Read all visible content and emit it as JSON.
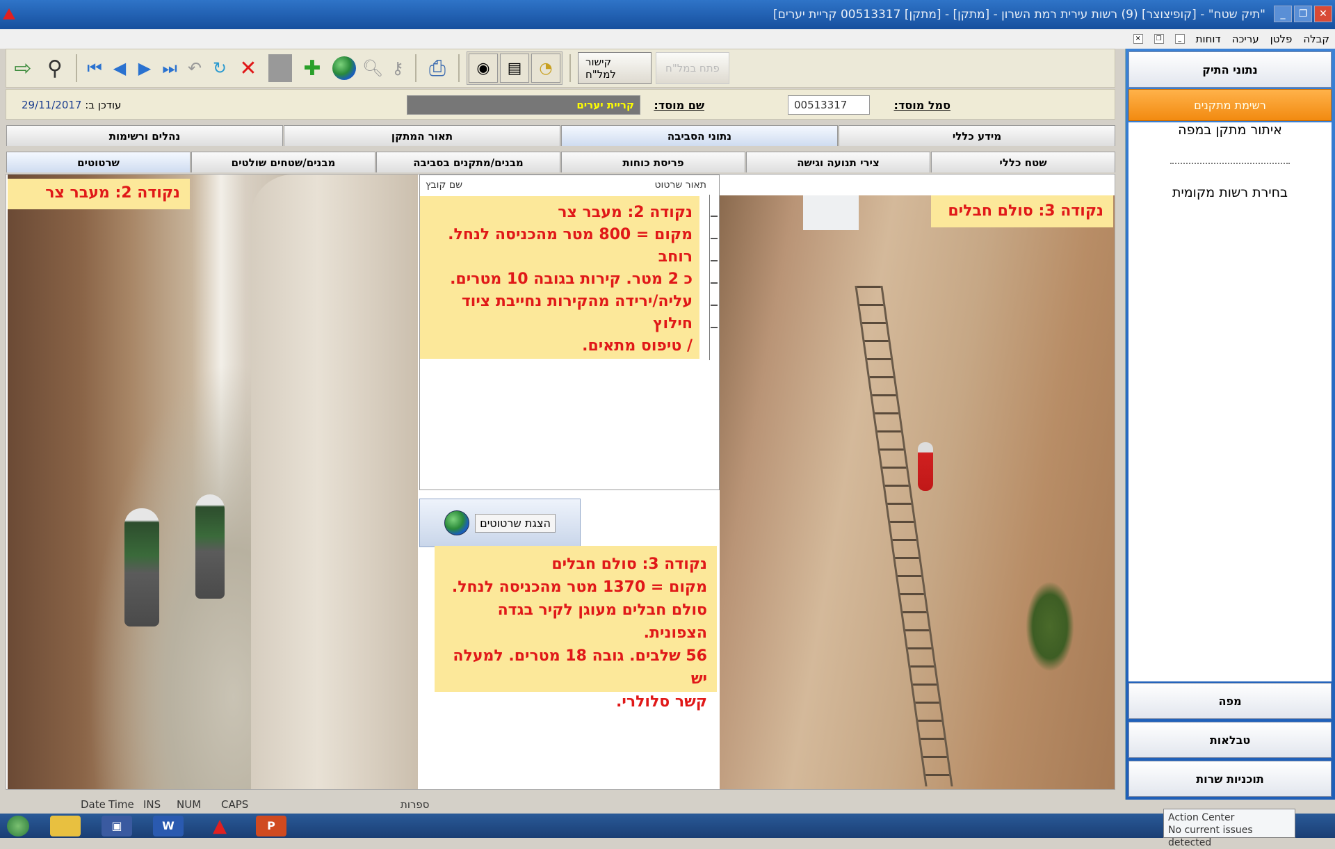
{
  "window": {
    "title": "\"תיק שטח\" - [קופיצוצר] (9) רשות עירית רמת השרון - [מתקן] - [מתקן] 00513317 קריית יערים]"
  },
  "menu": {
    "items": [
      "קבלה",
      "פלטן",
      "עריכה",
      "דוחות"
    ]
  },
  "toolbar": {
    "icons": [
      "exit-icon",
      "binoculars-icon",
      "first-record-icon",
      "prev-record-icon",
      "next-record-icon",
      "last-record-icon",
      "undo-icon",
      "refresh-icon",
      "delete-icon",
      "blank-icon",
      "add-icon",
      "globe-icon",
      "search-icon",
      "key-icon",
      "print-icon",
      "camera-icon",
      "scanner-icon",
      "chart-icon"
    ],
    "link_label": "קישור למל\"ח",
    "open_label": "פתח במל\"ח"
  },
  "info": {
    "org_code_label": "סמל מוסד:",
    "org_code_value": "00513317",
    "org_name_label": "שם מוסד:",
    "org_name_value": "קריית יערים",
    "updated_label": "עודכן ב:",
    "updated_value": "29/11/2017"
  },
  "tabs_top": [
    "מידע כללי",
    "נתוני הסביבה",
    "תאור המתקן",
    "נהלים ורשימות"
  ],
  "tabs_top_active": 1,
  "tabs_sub": [
    "שטח כללי",
    "צירי תנועה וגישה",
    "פריסת כוחות",
    "מבנים/מתקנים בסביבה",
    "מבנים/שטחים שולטים",
    "שרטוטים"
  ],
  "tabs_sub_active": 5,
  "content": {
    "label_left": "נקודה 2: מעבר צר",
    "label_right": "נקודה 3: סולם חבלים",
    "grid_header_desc": "תאור שרטוט",
    "grid_header_file": "שם קובץ",
    "note1": [
      "נקודה 2: מעבר צר",
      "מקום = 800 מטר מהכניסה לנחל. רוחב",
      "כ 2 מטר. קירות בגובה 10 מטרים.",
      "עליה/ירידה מהקירות נחייבת ציוד חילוץ",
      "/ טיפוס מתאים."
    ],
    "show_button_label": "הצגת שרטוטים",
    "note2": [
      "נקודה 3: סולם חבלים",
      "מקום = 1370 מטר מהכניסה לנחל.",
      "סולם חבלים מעוגן לקיר בגדה הצפונית.",
      "56 שלבים. גובה 18 מטרים. למעלה יש",
      "קשר סלולרי."
    ]
  },
  "statusbar": {
    "items": [
      "Date",
      "Time",
      "INS",
      "NUM",
      "CAPS"
    ],
    "right": "ספרות"
  },
  "sidebar": {
    "top_buttons": [
      "נתוני התיק",
      "רשימת מתקנים"
    ],
    "selected_index": 1,
    "panel_items": [
      "איתור מתקן במפה",
      "בחירת רשות מקומית"
    ],
    "bottom_buttons": [
      "מפה",
      "טבלאות",
      "תוכניות שרות"
    ]
  },
  "taskbar": {
    "apps": [
      "start-icon",
      "folder-icon",
      "save-icon",
      "word-icon",
      "warning-icon",
      "powerpoint-icon"
    ],
    "action_center_title": "Action Center",
    "action_center_text": "No current issues detected"
  }
}
